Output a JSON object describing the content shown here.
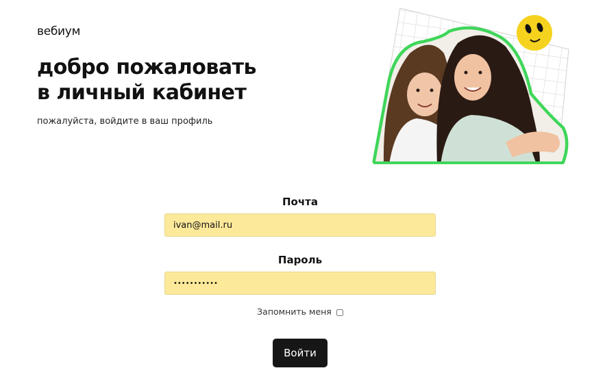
{
  "header": {
    "logo_text": "вебиум",
    "title_line1": "добро пожаловать",
    "title_line2": "в личный кабинет",
    "subtitle": "пожалуйста, войдите в ваш профиль"
  },
  "hero": {
    "image_description_icon": "smiley-sticker-icon",
    "accent_color": "#3fd65a",
    "sticker_color": "#f5d21e"
  },
  "form": {
    "email_label": "Почта",
    "email_value": "ivan@mail.ru",
    "password_label": "Пароль",
    "password_value": "•••••••••••",
    "remember_label": "Запомнить меня",
    "remember_checked": false,
    "submit_label": "Войти"
  },
  "colors": {
    "field_bg": "#fde99a",
    "button_bg": "#161616",
    "button_text": "#ffffff"
  }
}
